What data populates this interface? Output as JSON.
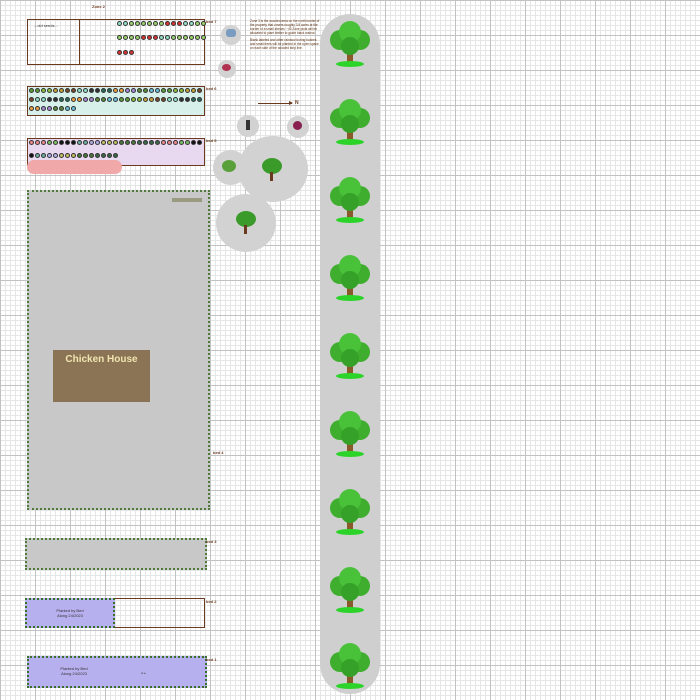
{
  "beds": {
    "bed7": {
      "label": "bed 7",
      "cell_label": "...old seeds..."
    },
    "bed6": {
      "label": "bed 6"
    },
    "bed5": {
      "label": "bed 5"
    },
    "bed4": {
      "label": "bed 4"
    },
    "bed3": {
      "label": "bed 3"
    },
    "bed2": {
      "label": "bed 2",
      "planted_text_line1": "Planted by Bed",
      "planted_text_line2": "Along 24/2023"
    },
    "bed1": {
      "label": "bed 1",
      "planted_text_line1": "Planted by Bed",
      "planted_text_line2": "Along 24/2023",
      "inner_label": "w.e."
    }
  },
  "zone": {
    "label": "Zone 2"
  },
  "chicken_house": {
    "label": "Chicken House"
  },
  "north_arrow": {
    "label": "N"
  },
  "note": {
    "paragraph1": "Zone 3 is the wooded area on the north border of the property that covers roughly 3.8 acres at the border of a small stream. ~40 Zone plots will be allocated to plant timber to guide black walnut.",
    "paragraph2": "Blank labeled and other rainbow boring bushes and small trees will be planted in the open space on each side of the wooded strip line."
  },
  "colors": {
    "bed_border": "#6b3a1e",
    "fence": "#4f7a3c",
    "planted": "#b7b0ef",
    "chicken_house": "#8b7355",
    "tree_lane": "#cfcfcf"
  }
}
